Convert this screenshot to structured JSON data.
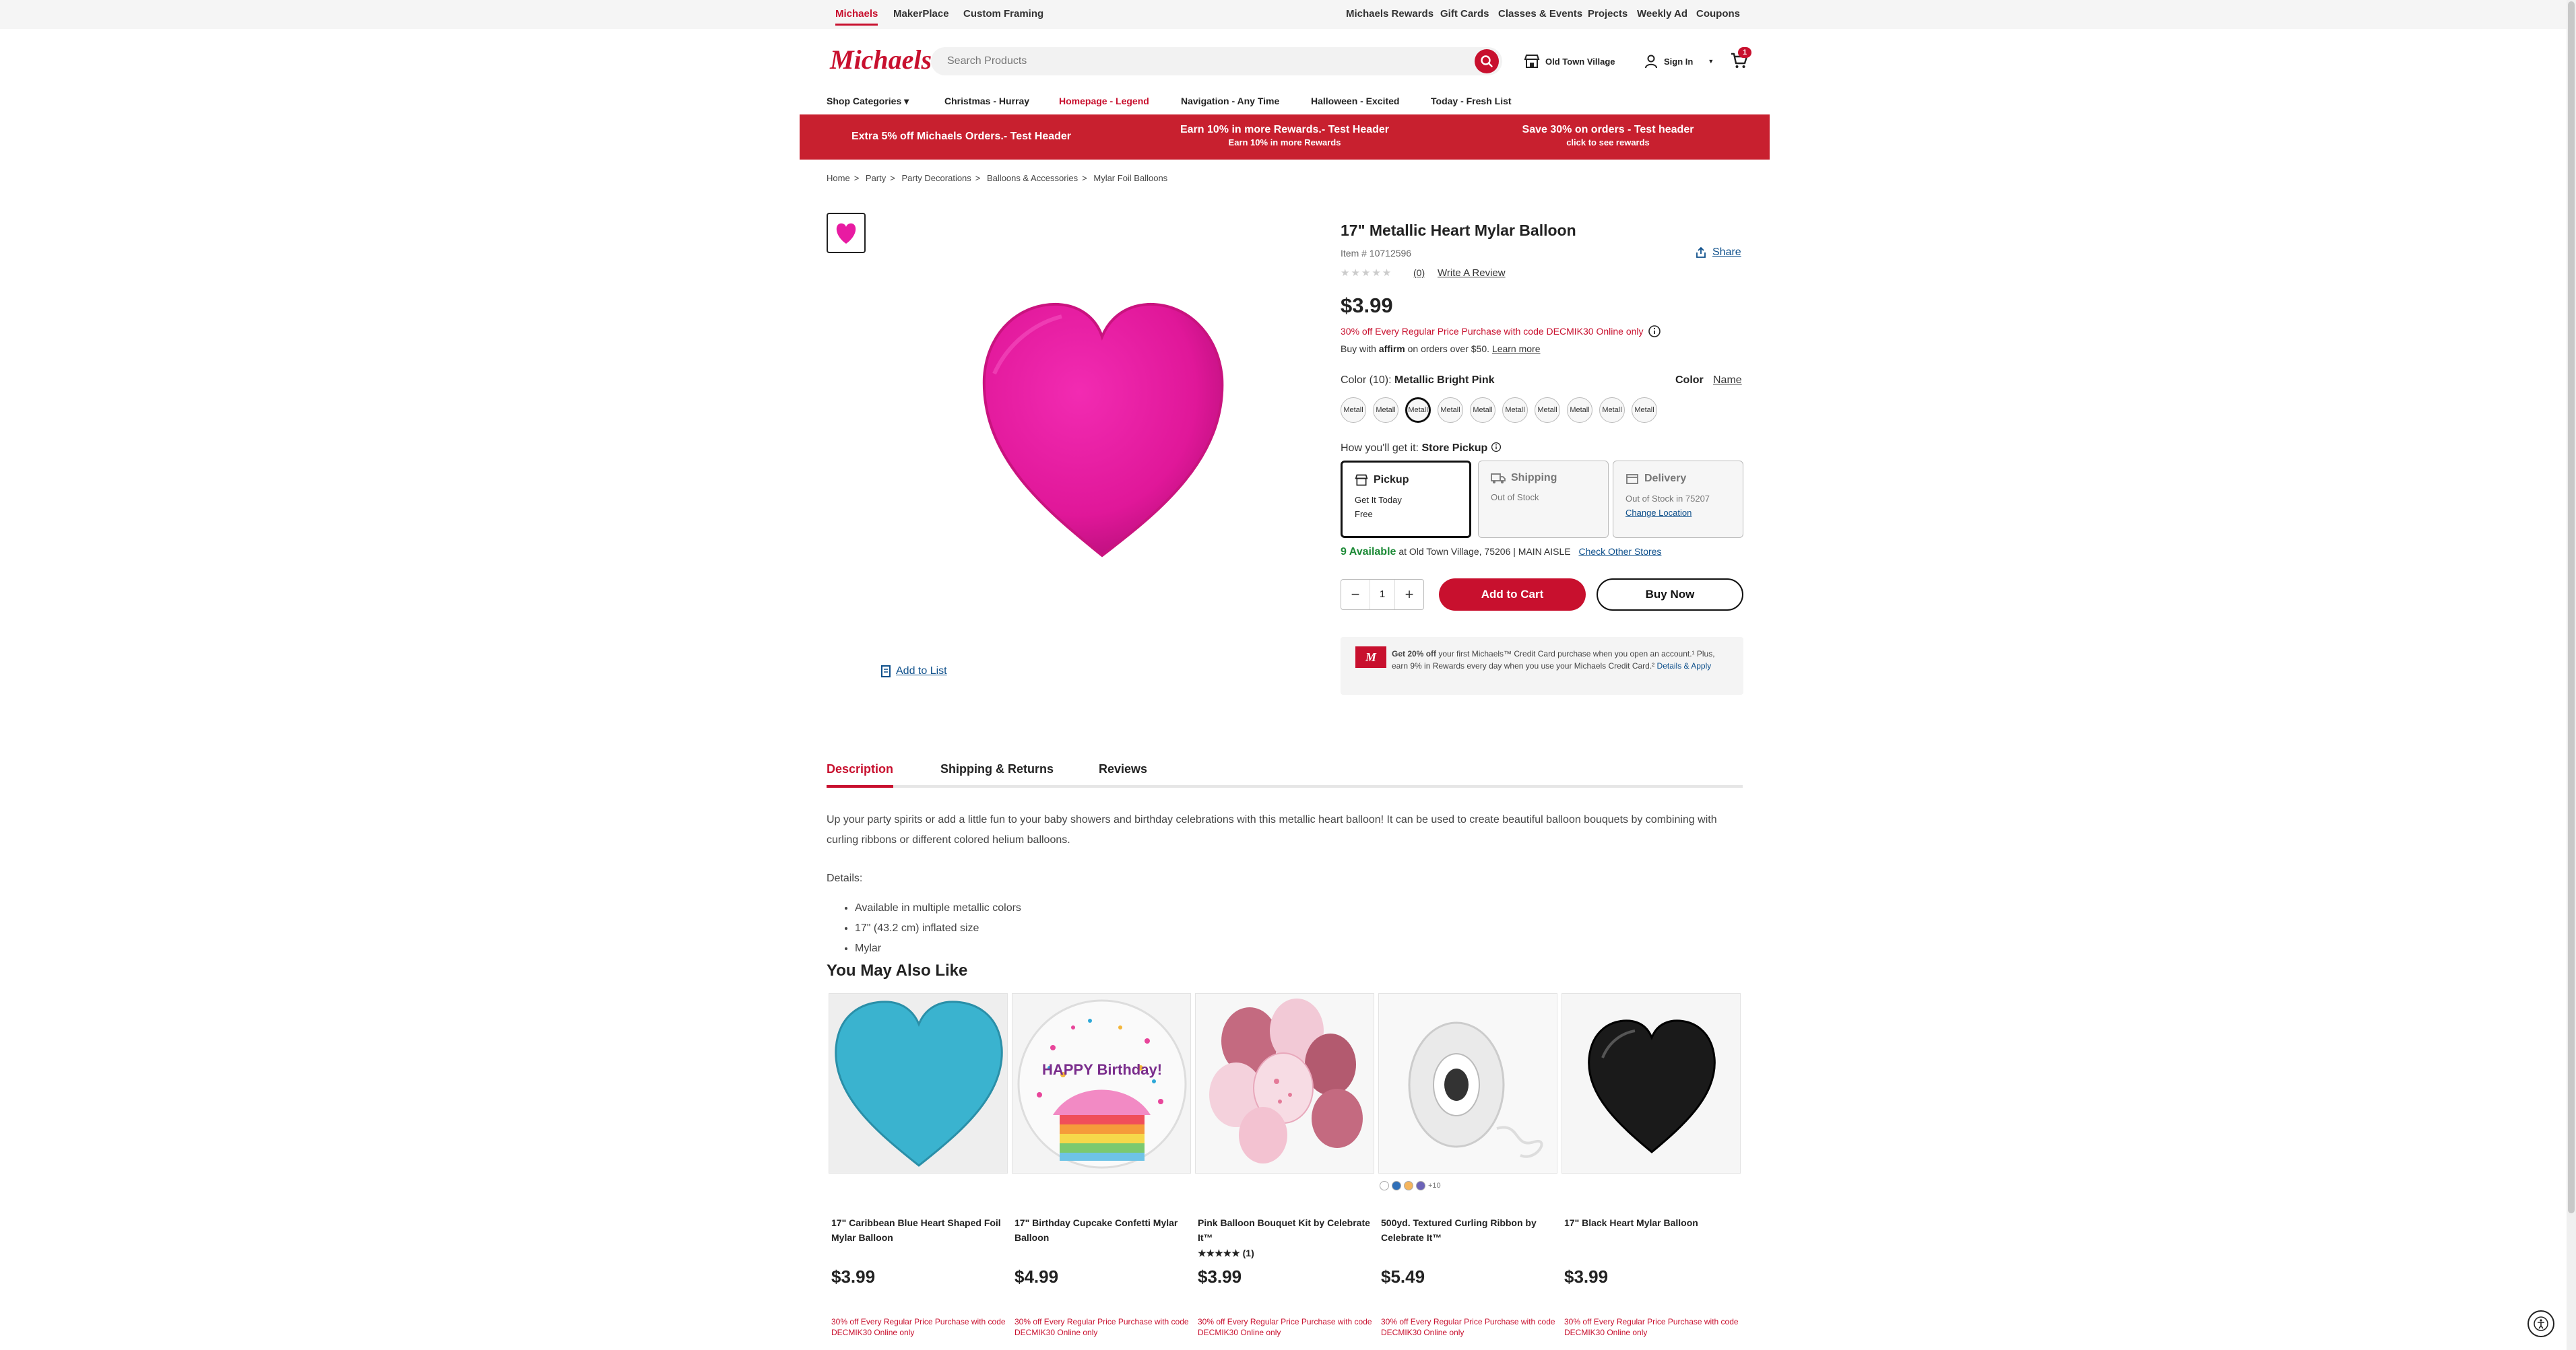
{
  "topbar": {
    "left": [
      "Michaels",
      "MakerPlace",
      "Custom Framing"
    ],
    "right": [
      "Michaels Rewards",
      "Gift Cards",
      "Classes & Events",
      "Projects",
      "Weekly Ad",
      "Coupons"
    ]
  },
  "header": {
    "logo": "Michaels",
    "search_placeholder": "Search Products",
    "store": "Old Town Village",
    "sign_in": "Sign In",
    "cart_count": "1"
  },
  "nav": [
    "Shop Categories",
    "Christmas - Hurray",
    "Homepage - Legend",
    "Navigation - Any Time",
    "Halloween - Excited",
    "Today - Fresh List"
  ],
  "promo": [
    {
      "title": "Extra 5% off Michaels Orders.- Test Header",
      "sub": ""
    },
    {
      "title": "Earn 10% in more Rewards.- Test Header",
      "sub": "Earn 10% in more Rewards"
    },
    {
      "title": "Save 30% on orders - Test header",
      "sub": "click to see rewards"
    }
  ],
  "breadcrumb": [
    "Home",
    "Party",
    "Party Decorations",
    "Balloons & Accessories",
    "Mylar Foil Balloons"
  ],
  "product": {
    "title": "17\" Metallic Heart Mylar Balloon",
    "item": "Item # 10712596",
    "review_count": "(0)",
    "write_review": "Write A Review",
    "share": "Share",
    "add_to_list": "Add to List",
    "price": "$3.99",
    "promo_msg": "30% off Every Regular Price Purchase with code DECMIK30 Online only",
    "affirm_pre": "Buy with",
    "affirm_brand": "affirm",
    "affirm_post": "on orders over $50.",
    "learn_more": "Learn more",
    "color_label": "Color (10):",
    "color_value": "Metallic Bright Pink",
    "color_toggle_a": "Color",
    "color_toggle_b": "Name",
    "swatch_text": "Metall",
    "swatch_count": 10,
    "selected_swatch": 3,
    "how_label": "How you'll get it:",
    "how_value": "Store Pickup"
  },
  "fulfillment": [
    {
      "title": "Pickup",
      "line1": "Get It Today",
      "line2": "Free",
      "link": ""
    },
    {
      "title": "Shipping",
      "line1": "Out of Stock",
      "line2": "",
      "link": ""
    },
    {
      "title": "Delivery",
      "line1": "Out of Stock in",
      "line2": "75207",
      "link": "Change Location"
    }
  ],
  "availability": {
    "count": "9 Available",
    "detail": "at Old Town Village, 75206 | MAIN AISLE",
    "link": "Check Other Stores"
  },
  "cart_actions": {
    "qty": "1",
    "add_to_cart": "Add to Cart",
    "buy_now": "Buy Now"
  },
  "credit_card": {
    "logo": "M",
    "bold": "Get 20% off",
    "text": "your first Michaels™ Credit Card purchase when you open an account.¹ Plus, earn 9% in Rewards every day when you use your Michaels Credit Card.²",
    "link": "Details & Apply"
  },
  "tabs": [
    "Description",
    "Shipping & Returns",
    "Reviews"
  ],
  "description": {
    "body": "Up your party spirits or add a little fun to your baby showers and birthday celebrations with this metallic heart balloon! It can be used to create beautiful balloon bouquets by combining with curling ribbons or different colored helium balloons.",
    "details_label": "Details:",
    "bullets": [
      "Available in multiple metallic colors",
      "17\" (43.2 cm) inflated size",
      "Mylar"
    ]
  },
  "recommendations": {
    "title": "You May Also Like",
    "promo": "30% off Every Regular Price Purchase with code DECMIK30 Online only",
    "items": [
      {
        "name": "17\" Caribbean Blue Heart Shaped Foil Mylar Balloon",
        "price": "$3.99",
        "rating": ""
      },
      {
        "name": "17\" Birthday Cupcake Confetti Mylar Balloon",
        "price": "$4.99",
        "rating": "",
        "balloon_text": "HAPPY Birthday!"
      },
      {
        "name": "Pink Balloon Bouquet Kit by Celebrate It™",
        "price": "$3.99",
        "rating": "★★★★★ (1)"
      },
      {
        "name": "500yd. Textured Curling Ribbon by Celebrate It™",
        "price": "$5.49",
        "rating": ""
      },
      {
        "name": "17\" Black Heart Mylar Balloon",
        "price": "$3.99",
        "rating": ""
      }
    ],
    "swatch_more": "+10"
  },
  "colors": {
    "brand_red": "#c8102e",
    "pink": "#e81ba2",
    "link_blue": "#0d4f8b"
  }
}
